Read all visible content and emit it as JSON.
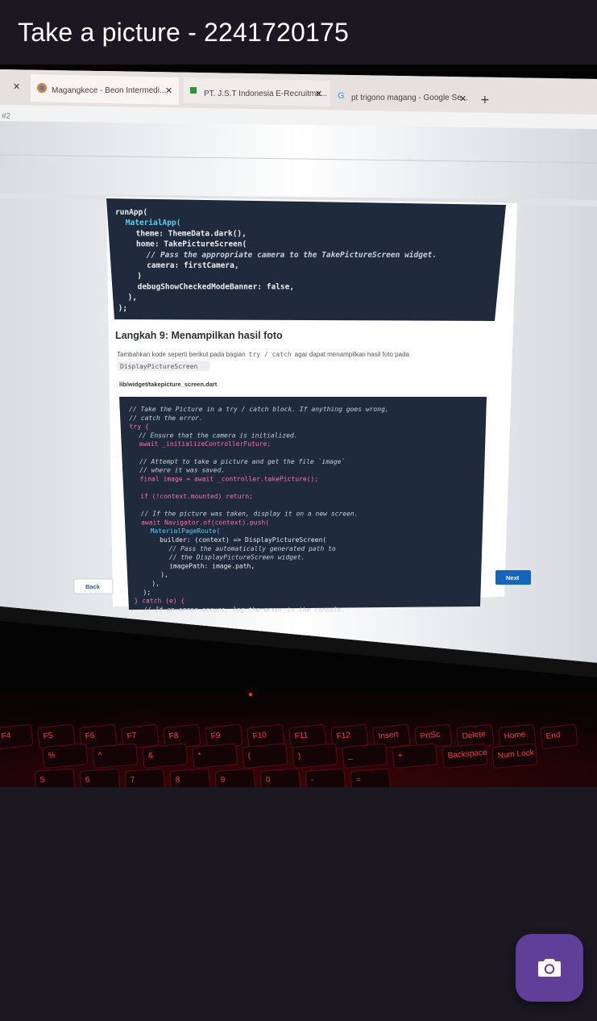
{
  "appbar": {
    "title": "Take a picture - 2241720175"
  },
  "photo": {
    "browser_tabs": [
      {
        "label": "Magangkece - Beon Intermedi..."
      },
      {
        "label": "PT. J.S.T Indonesia E-Recruitme..."
      },
      {
        "label": "pt trigono magang - Google Se..."
      }
    ],
    "address_text": "#2",
    "code_block_1": [
      "runApp(",
      "  MaterialApp(",
      "    theme: ThemeData.dark(),",
      "    home: TakePictureScreen(",
      "      // Pass the appropriate camera to the TakePictureScreen widget.",
      "      camera: firstCamera,",
      "    )",
      "    debugShowCheckedModeBanner: false,",
      "  ),",
      ");"
    ],
    "section_heading": "Langkah 9: Menampilkan hasil foto",
    "paragraph_pre": "Tambahkan kode seperti berikut pada bagian",
    "paragraph_code": "try / catch",
    "paragraph_post": "agar dapat menampilkan hasil foto pada",
    "paragraph_code2": "DisplayPictureScreen",
    "file_path": "lib/widget/takepicture_screen.dart",
    "code_block_2": [
      "// Take the Picture in a try / catch block. If anything goes wrong,",
      "// catch the error.",
      "try {",
      "  // Ensure that the camera is initialized.",
      "  await _initializeControllerFuture;",
      "",
      "  // Attempt to take a picture and get the file `image`",
      "  // where it was saved.",
      "  final image = await _controller.takePicture();",
      "",
      "  if (!context.mounted) return;",
      "",
      "  // If the picture was taken, display it on a new screen.",
      "  await Navigator.of(context).push(",
      "    MaterialPageRoute(",
      "      builder: (context) => DisplayPictureScreen(",
      "        // Pass the automatically generated path to",
      "        // the DisplayPictureScreen widget.",
      "        imagePath: image.path,",
      "      ),",
      "    ),",
      "  );",
      "} catch (e) {",
      "  // If an error occurs, log the error to the console."
    ],
    "back_label": "Back",
    "next_label": "Next",
    "keyboard_keys": [
      "F4",
      "F5",
      "F6",
      "F7",
      "F8",
      "F9",
      "F10",
      "F11",
      "F12",
      "Insert",
      "PrtSc",
      "Delete",
      "Home",
      "End",
      "%",
      "^",
      "&",
      "*",
      "(",
      ")",
      "_",
      "+",
      "Backspace",
      "Num Lock",
      "5",
      "6",
      "7",
      "8",
      "9",
      "0",
      "-",
      "="
    ]
  },
  "fab": {
    "icon": "camera-icon"
  },
  "colors": {
    "background": "#1b1822",
    "fab": "#5f3f98",
    "code_bg": "#1f2b3d",
    "keyboard_glow": "#e0202a"
  }
}
